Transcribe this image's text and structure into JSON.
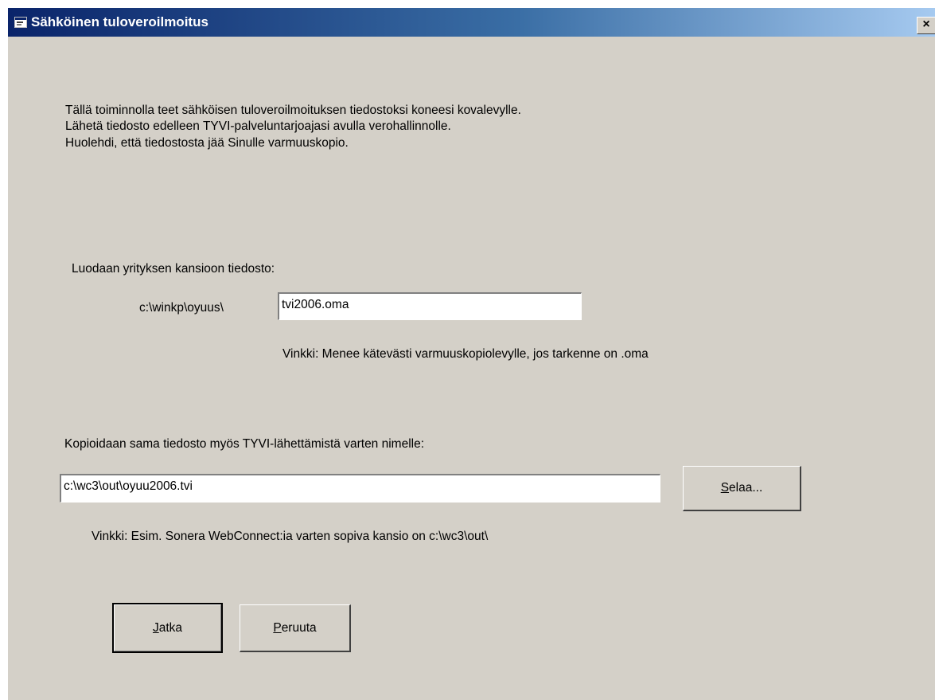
{
  "window": {
    "title": "Sähköinen tuloveroilmoitus",
    "close_label": "×",
    "icon": "app-window-icon"
  },
  "intro": {
    "line1": "Tällä toiminnolla teet sähköisen tuloveroilmoituksen tiedostoksi koneesi kovalevylle.",
    "line2": "Lähetä tiedosto edelleen TYVI-palveluntarjoajasi avulla verohallinnolle.",
    "line3": "Huolehdi, että tiedostosta jää Sinulle varmuuskopio."
  },
  "company_file": {
    "label": "Luodaan yrityksen kansioon tiedosto:",
    "path_prefix": "c:\\winkp\\oyuus\\",
    "filename": "tvi2006.oma",
    "hint": "Vinkki: Menee kätevästi varmuuskopiolevylle, jos tarkenne on .oma"
  },
  "tyvi_copy": {
    "label": "Kopioidaan sama tiedosto myös TYVI-lähettämistä varten nimelle:",
    "path": "c:\\wc3\\out\\oyuu2006.tvi",
    "browse": {
      "mnemonic": "S",
      "rest": "elaa..."
    },
    "hint": "Vinkki: Esim. Sonera WebConnect:ia varten sopiva kansio on c:\\wc3\\out\\"
  },
  "buttons": {
    "continue": {
      "mnemonic": "J",
      "rest": "atka"
    },
    "cancel": {
      "mnemonic": "P",
      "rest": "eruuta"
    }
  },
  "colors": {
    "face": "#d4d0c8",
    "title_start": "#0a246a",
    "title_end": "#a6caf0"
  }
}
